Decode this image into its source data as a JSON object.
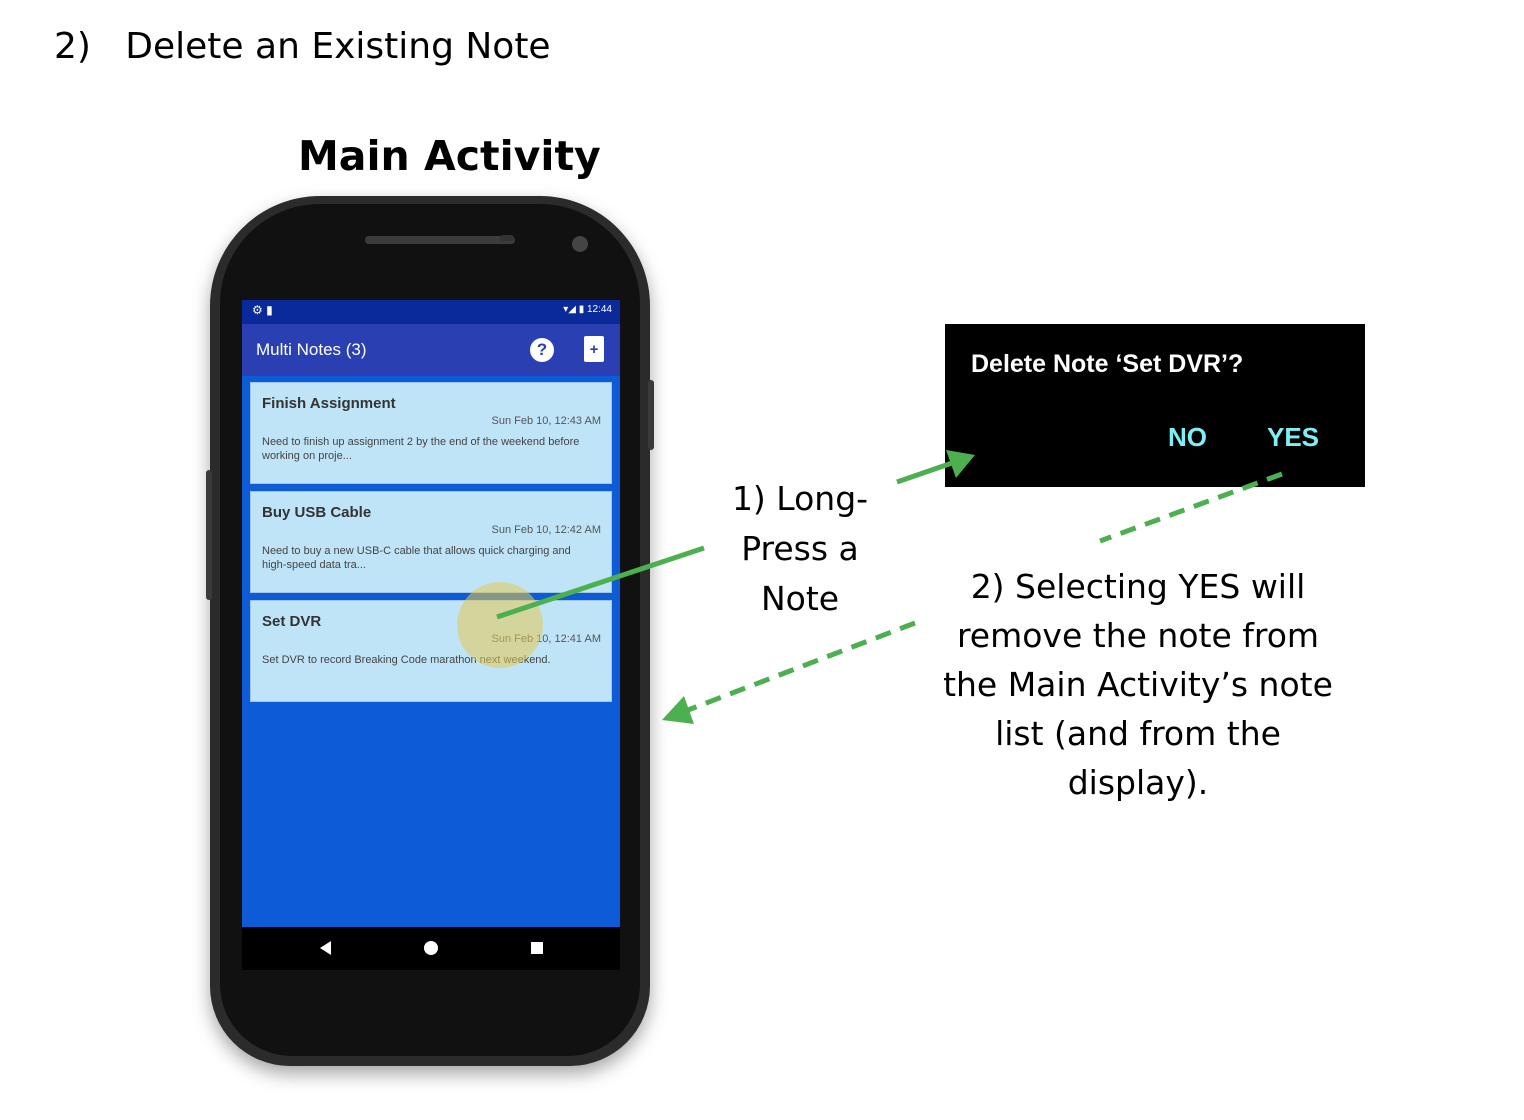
{
  "heading": "2)   Delete an Existing Note",
  "screen_title": "Main Activity",
  "phone": {
    "status_left": "⚙ ▮",
    "status_right": "▾◢ ▮ 12:44",
    "app_title": "Multi Notes (3)",
    "help_icon_glyph": "?",
    "add_icon_glyph": "+",
    "notes": [
      {
        "title": "Finish Assignment",
        "date": "Sun Feb 10, 12:43 AM",
        "body": "Need to finish up assignment 2 by the end of the weekend before working on proje..."
      },
      {
        "title": "Buy USB Cable",
        "date": "Sun Feb 10, 12:42 AM",
        "body": "Need to buy a new USB-C cable that allows quick charging and high-speed data tra..."
      },
      {
        "title": "Set DVR",
        "date": "Sun Feb 10, 12:41 AM",
        "body": "Set DVR to record Breaking Code marathon next weekend."
      }
    ]
  },
  "dialog": {
    "title": "Delete Note ‘Set DVR’?",
    "no_label": "NO",
    "yes_label": "YES"
  },
  "annotations": {
    "step1": [
      "1) Long-",
      "Press a",
      "Note"
    ],
    "step2": [
      "2) Selecting YES will",
      "remove the note from",
      "the Main Activity’s note",
      "list (and from the",
      "display)."
    ]
  },
  "colors": {
    "arrow": "#4caf50",
    "dialog_button": "#7ef0f5",
    "app_bar": "#2a3fb1",
    "screen_bg": "#0d5bd6",
    "note_card": "#bfe4f8"
  }
}
